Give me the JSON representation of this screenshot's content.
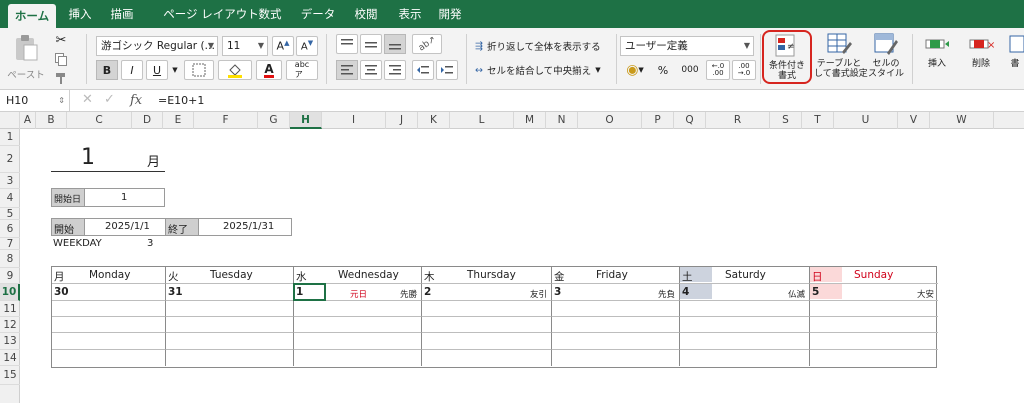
{
  "ribbon_tabs": [
    "ホーム",
    "挿入",
    "描画",
    "ページ レイアウト",
    "数式",
    "データ",
    "校閲",
    "表示",
    "開発"
  ],
  "ribbon": {
    "paste_label": "ペースト",
    "font_name": "游ゴシック Regular (…",
    "font_size": "11",
    "bold": "B",
    "italic": "I",
    "underline": "U",
    "wrap_text": "折り返して全体を表示する",
    "merge_center": "セルを結合して中央揃え",
    "number_format": "ユーザー定義",
    "percent": "%",
    "comma": "000",
    "cond_format": "条件付き\n書式",
    "table_format": "テーブルと\nして書式設定",
    "cell_style": "セルの\nスタイル",
    "insert": "挿入",
    "delete": "削除",
    "format": "書"
  },
  "formula_bar": {
    "name_box": "H10",
    "fx": "fx",
    "formula": "=E10+1"
  },
  "columns": [
    "A",
    "B",
    "C",
    "D",
    "E",
    "F",
    "G",
    "H",
    "I",
    "J",
    "K",
    "L",
    "M",
    "N",
    "O",
    "P",
    "Q",
    "R",
    "S",
    "T",
    "U",
    "V",
    "W"
  ],
  "rows": [
    "1",
    "2",
    "3",
    "4",
    "5",
    "6",
    "7",
    "8",
    "9",
    "10",
    "11",
    "12",
    "13",
    "14",
    "15"
  ],
  "sheet": {
    "month_value": "1",
    "month_unit": "月",
    "start_day_label": "開始日",
    "start_day_value": "1",
    "start_label": "開始",
    "start_date": "2025/1/1",
    "end_label": "終了",
    "end_date": "2025/1/31",
    "weekday_label": "WEEKDAY",
    "weekday_value": "3"
  },
  "calendar": {
    "headers": [
      {
        "jp": "月",
        "en": "Monday"
      },
      {
        "jp": "火",
        "en": "Tuesday"
      },
      {
        "jp": "水",
        "en": "Wednesday"
      },
      {
        "jp": "木",
        "en": "Thursday"
      },
      {
        "jp": "金",
        "en": "Friday"
      },
      {
        "jp": "土",
        "en": "Saturdy"
      },
      {
        "jp": "日",
        "en": "Sunday"
      }
    ],
    "days": [
      {
        "num": "30",
        "note": "",
        "rokuyo": ""
      },
      {
        "num": "31",
        "note": "",
        "rokuyo": ""
      },
      {
        "num": "1",
        "note": "元日",
        "rokuyo": "先勝"
      },
      {
        "num": "2",
        "note": "",
        "rokuyo": "友引"
      },
      {
        "num": "3",
        "note": "",
        "rokuyo": "先負"
      },
      {
        "num": "4",
        "note": "",
        "rokuyo": "仏滅"
      },
      {
        "num": "5",
        "note": "",
        "rokuyo": "大安"
      }
    ]
  },
  "colors": {
    "excel_green": "#1e7145",
    "saturday_bg": "#cdd3de",
    "sunday_bg": "#fbd9d9",
    "red_text": "#d0021b",
    "highlight_ring": "#d6251f"
  }
}
